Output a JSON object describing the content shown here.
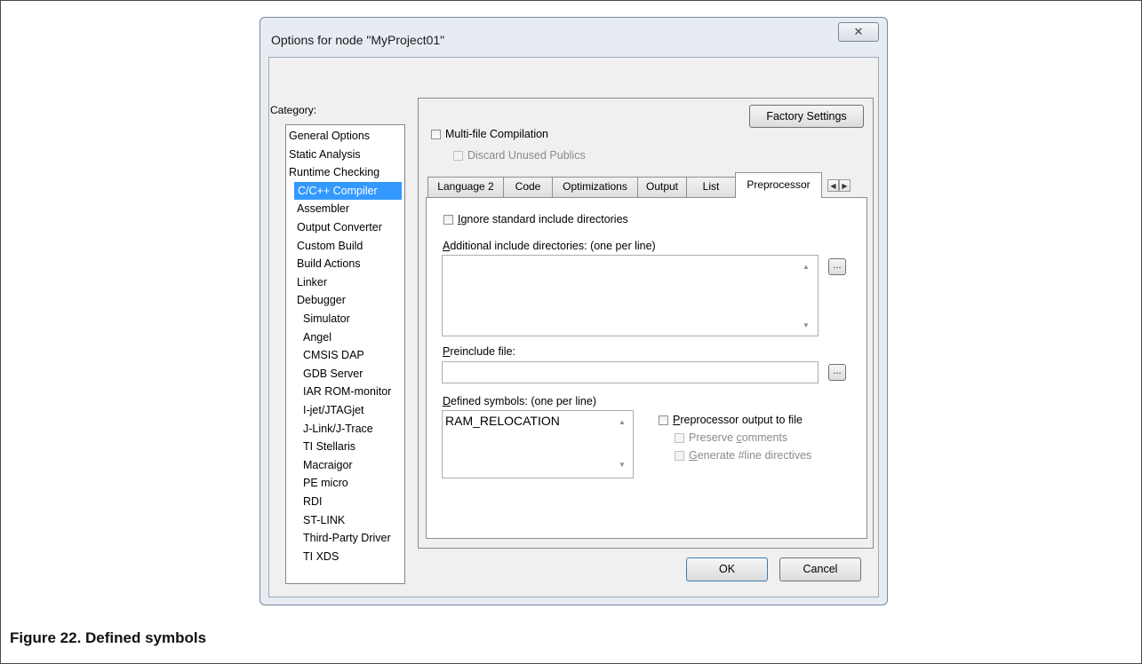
{
  "caption": "Figure 22. Defined symbols",
  "dialog": {
    "title": "Options for node \"MyProject01\"",
    "close_glyph": "✕",
    "category_label": "Category:",
    "categories": [
      {
        "label": "General Options",
        "sub": false,
        "selected": false
      },
      {
        "label": "Static Analysis",
        "sub": false,
        "selected": false
      },
      {
        "label": "Runtime Checking",
        "sub": false,
        "selected": false
      },
      {
        "label": "C/C++ Compiler",
        "sub": true,
        "selected": true
      },
      {
        "label": "Assembler",
        "sub": true,
        "selected": false
      },
      {
        "label": "Output Converter",
        "sub": true,
        "selected": false
      },
      {
        "label": "Custom Build",
        "sub": true,
        "selected": false
      },
      {
        "label": "Build Actions",
        "sub": true,
        "selected": false
      },
      {
        "label": "Linker",
        "sub": true,
        "selected": false
      },
      {
        "label": "Debugger",
        "sub": true,
        "selected": false
      },
      {
        "label": "Simulator",
        "sub": true,
        "selected": false
      },
      {
        "label": "Angel",
        "sub": true,
        "selected": false
      },
      {
        "label": "CMSIS DAP",
        "sub": true,
        "selected": false
      },
      {
        "label": "GDB Server",
        "sub": true,
        "selected": false
      },
      {
        "label": "IAR ROM-monitor",
        "sub": true,
        "selected": false
      },
      {
        "label": "I-jet/JTAGjet",
        "sub": true,
        "selected": false
      },
      {
        "label": "J-Link/J-Trace",
        "sub": true,
        "selected": false
      },
      {
        "label": "TI Stellaris",
        "sub": true,
        "selected": false
      },
      {
        "label": "Macraigor",
        "sub": true,
        "selected": false
      },
      {
        "label": "PE micro",
        "sub": true,
        "selected": false
      },
      {
        "label": "RDI",
        "sub": true,
        "selected": false
      },
      {
        "label": "ST-LINK",
        "sub": true,
        "selected": false
      },
      {
        "label": "Third-Party Driver",
        "sub": true,
        "selected": false
      },
      {
        "label": "TI XDS",
        "sub": true,
        "selected": false
      }
    ],
    "factory_settings": "Factory Settings",
    "multi_file": "Multi-file Compilation",
    "discard_unused": "Discard Unused Publics",
    "tabs": [
      "Language 2",
      "Code",
      "Optimizations",
      "Output",
      "List",
      "Preprocessor"
    ],
    "active_tab": "Preprocessor",
    "tab_scroll_left": "◀",
    "tab_scroll_right": "▶",
    "preprocessor": {
      "ignore_std_prefix": "I",
      "ignore_std_rest": "gnore standard include directories",
      "additional_prefix": "A",
      "additional_rest": "dditional include directories: (one per line)",
      "additional_value": "",
      "preinclude_prefix": "P",
      "preinclude_rest": "reinclude file:",
      "preinclude_value": "",
      "defined_prefix": "D",
      "defined_rest": "efined symbols: (one per line)",
      "defined_value": "RAM_RELOCATION",
      "pp_output_prefix": "P",
      "pp_output_rest": "reprocessor output to file",
      "preserve_prefix": "Preserve ",
      "preserve_u": "c",
      "preserve_rest": "omments",
      "generate_prefix": "G",
      "generate_rest": "enerate #line directives",
      "browse": "..."
    },
    "ok": "OK",
    "cancel": "Cancel"
  }
}
